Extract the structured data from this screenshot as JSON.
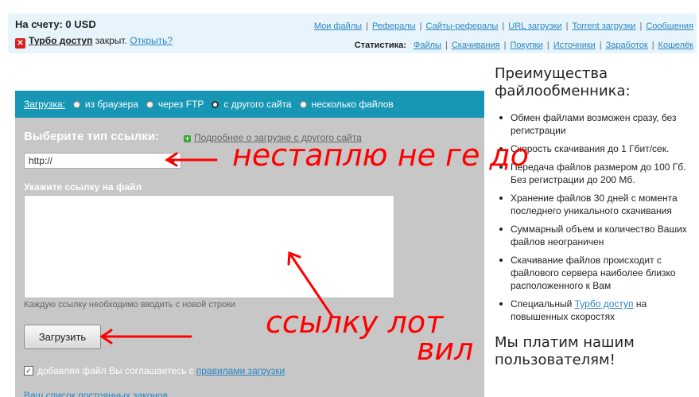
{
  "account": {
    "balance": "На счету: 0 USD",
    "turbo_label": "Турбо доступ",
    "turbo_status": "закрыт.",
    "turbo_open": "Открыть?"
  },
  "nav": [
    "Мои файлы",
    "Рефералы",
    "Сайты-рефералы",
    "URL загрузки",
    "Torrent загрузки",
    "Сообщения"
  ],
  "stats": {
    "label": "Статистика:",
    "links": [
      "Файлы",
      "Скачивания",
      "Покупки",
      "Источники",
      "Заработок",
      "Кошелёк"
    ]
  },
  "upload": {
    "header_label": "Загрузка:",
    "options": [
      {
        "label": "из браузера",
        "selected": false
      },
      {
        "label": "через FTP",
        "selected": false
      },
      {
        "label": "с другого сайта",
        "selected": true
      },
      {
        "label": "несколько файлов",
        "selected": false
      }
    ],
    "type_heading": "Выберите тип ссылки:",
    "more_link": "Подробнее о загрузке с другого сайта",
    "select_value": "http://",
    "url_label": "Укажите ссылку на файл",
    "hint": "Каждую ссылку необходимо вводить с новой строки",
    "button": "Загрузить",
    "agree_text": "добавляя файл Вы соглашаетесь с",
    "agree_link": "правилами загрузки",
    "agree_checked": true,
    "bottom_link": "Ваш список постоянных законов"
  },
  "sidebar": {
    "title": "Преимущества файлообменника:",
    "items": [
      "Обмен файлами возможен сразу, без регистрации",
      "Скорость скачивания до 1 Гбит/сек.",
      "Передача файлов размером до 100 Гб. Без регистрации до 200 Мб.",
      "Хранение файлов 30 дней с момента последнего уникального скачивания",
      "Суммарный объем и количество Ваших файлов неограничен",
      "Скачивание файлов происходит с файлового сервера наиболее близко расположенного к Вам"
    ],
    "last_item_pre": "Специальный",
    "last_item_link": "Турбо доступ",
    "last_item_post": "на повышенных скоростях",
    "pay_title": "Мы платим нашим пользователям!"
  },
  "annotations": {
    "color": "#ff0000",
    "text1": "нестаплю не ге до",
    "text2": "ссылку лот",
    "text3": "вил"
  },
  "colors": {
    "header": "#1797b5",
    "panel": "#c7c7c7",
    "link": "#2a86c4",
    "topbar": "#e8f4fb"
  }
}
